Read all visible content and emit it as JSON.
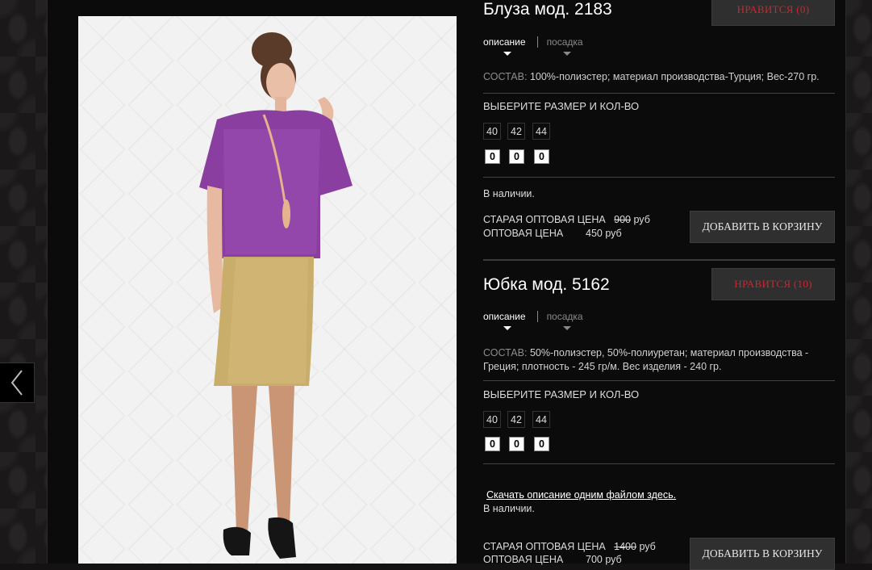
{
  "products": [
    {
      "title": "Блуза мод. 2183",
      "like_label": "НРАВИТСЯ (0)",
      "tabs": [
        {
          "label": "описание"
        },
        {
          "label": "посадка"
        }
      ],
      "composition_label": "СОСТАВ:",
      "composition_text": "100%-полиэстер; материал производства-Турция; Вес-270 гр.",
      "size_heading": "ВЫБЕРИТЕ РАЗМЕР И КОЛ-ВО",
      "sizes": [
        "40",
        "42",
        "44"
      ],
      "quantities": [
        "0",
        "0",
        "0"
      ],
      "stock": "В наличии.",
      "old_price_label": "СТАРАЯ ОПТОВАЯ ЦЕНА",
      "old_price": "900",
      "price_label": "ОПТОВАЯ ЦЕНА",
      "price": "450",
      "currency": "руб",
      "cart_label": "ДОБАВИТЬ В КОРЗИНУ"
    },
    {
      "title": "Юбка мод. 5162",
      "like_label": "НРАВИТСЯ (10)",
      "tabs": [
        {
          "label": "описание"
        },
        {
          "label": "посадка"
        }
      ],
      "composition_label": "СОСТАВ:",
      "composition_text": "50%-полиэстер, 50%-полиуретан; материал производства - Греция; плотность - 245 гр/м. Вес изделия - 240 гр.",
      "size_heading": "ВЫБЕРИТЕ РАЗМЕР И КОЛ-ВО",
      "sizes": [
        "40",
        "42",
        "44"
      ],
      "quantities": [
        "0",
        "0",
        "0"
      ],
      "download_link": "Скачать описание одним файлом здесь.",
      "stock": "В наличии.",
      "old_price_label": "СТАРАЯ ОПТОВАЯ ЦЕНА",
      "old_price": "1400",
      "price_label": "ОПТОВАЯ ЦЕНА",
      "price": "700",
      "currency": "руб",
      "cart_label": "ДОБАВИТЬ В КОРЗИНУ"
    }
  ],
  "icons": {
    "prev": "chevron-left-icon",
    "tab_caret": "caret-down-icon"
  },
  "colors": {
    "like_text": "#c9282f",
    "background": "#0b0b0b",
    "button_bg": "#2f2f2f"
  }
}
